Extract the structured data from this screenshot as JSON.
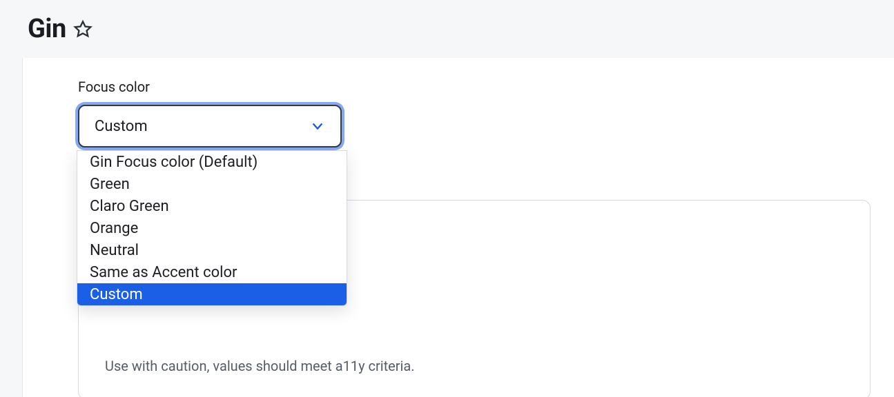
{
  "header": {
    "title": "Gin"
  },
  "form": {
    "focus_color": {
      "label": "Focus color",
      "selected": "Custom",
      "options": [
        "Gin Focus color (Default)",
        "Green",
        "Claro Green",
        "Orange",
        "Neutral",
        "Same as Accent color",
        "Custom"
      ],
      "hint": "Use with caution, values should meet a11y criteria."
    }
  }
}
